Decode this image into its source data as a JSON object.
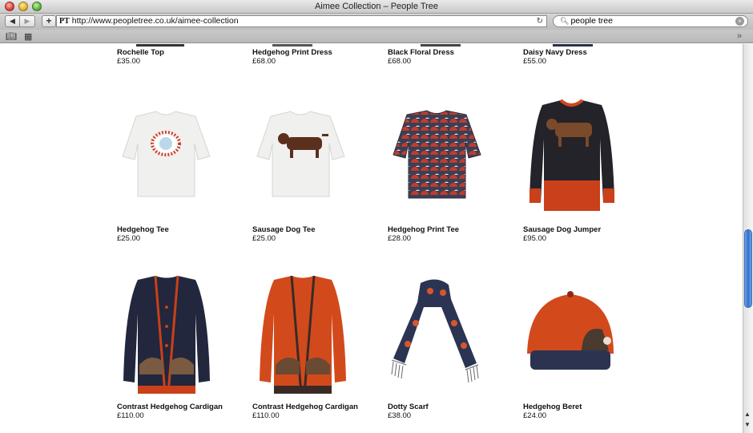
{
  "window": {
    "title": "Aimee Collection – People Tree"
  },
  "toolbar": {
    "back_label": "◀",
    "forward_label": "▶",
    "add_label": "+",
    "site_icon": "PT",
    "url": "http://www.peopletree.co.uk/aimee-collection",
    "reload_icon": "reload-icon",
    "search_value": "people tree"
  },
  "bookmarks": {
    "icons": [
      "book-icon",
      "grid-icon"
    ],
    "overflow": "»"
  },
  "products": [
    {
      "name": "Rochelle Top",
      "price": "£35.00"
    },
    {
      "name": "Hedgehog Print Dress",
      "price": "£68.00"
    },
    {
      "name": "Black Floral Dress",
      "price": "£68.00"
    },
    {
      "name": "Daisy Navy Dress",
      "price": "£55.00"
    },
    {
      "name": "Hedgehog Tee",
      "price": "£25.00"
    },
    {
      "name": "Sausage Dog Tee",
      "price": "£25.00"
    },
    {
      "name": "Hedgehog Print Tee",
      "price": "£28.00"
    },
    {
      "name": "Sausage Dog Jumper",
      "price": "£95.00"
    },
    {
      "name": "Contrast Hedgehog Cardigan",
      "price": "£110.00"
    },
    {
      "name": "Contrast Hedgehog Cardigan",
      "price": "£110.00"
    },
    {
      "name": "Dotty Scarf",
      "price": "£38.00"
    },
    {
      "name": "Hedgehog Beret",
      "price": "£24.00"
    }
  ]
}
